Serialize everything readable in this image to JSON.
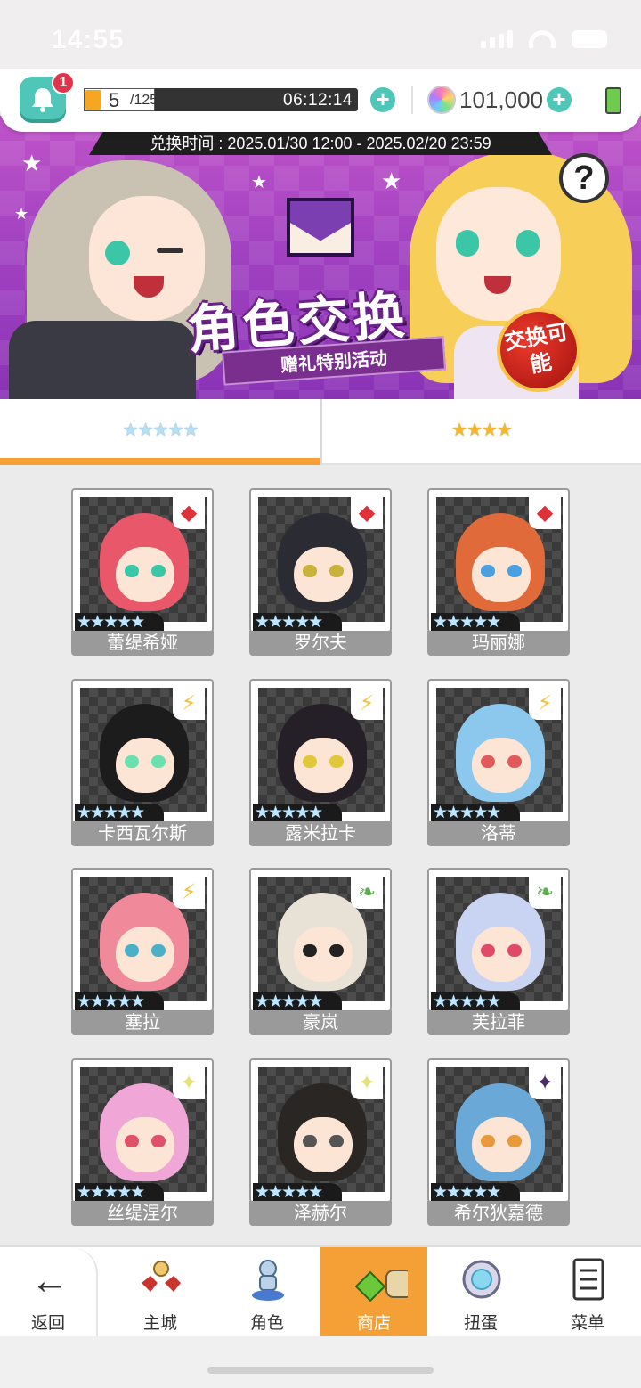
{
  "status_bar": {
    "time": "14:55"
  },
  "top_bar": {
    "notification_count": "1",
    "stamina_current": "5",
    "stamina_max": "/125",
    "stamina_fraction": 0.04,
    "stamina_timer": "06:12:14",
    "gems": "101,000"
  },
  "banner": {
    "exchange_time": "兑换时间 : 2025.01/30 12:00 - 2025.02/20 23:59",
    "title": "角色交换",
    "subtitle": "赠礼特别活动",
    "seal_text": "交换可能",
    "help_symbol": "?"
  },
  "tabs": [
    {
      "stars": "★★★★★",
      "active": true
    },
    {
      "stars": "★★★★",
      "active": false
    }
  ],
  "characters": [
    {
      "name": "蕾缇希娅",
      "rank": "★★★★★",
      "element": "fire",
      "hair": "#e8586a",
      "eye": "#3cc6a8"
    },
    {
      "name": "罗尔夫",
      "rank": "★★★★★",
      "element": "fire",
      "hair": "#2b2b33",
      "eye": "#c8b23a"
    },
    {
      "name": "玛丽娜",
      "rank": "★★★★★",
      "element": "fire",
      "hair": "#e06a3a",
      "eye": "#4aa0e0"
    },
    {
      "name": "卡西瓦尔斯",
      "rank": "★★★★★",
      "element": "lightning",
      "hair": "#1c1c1c",
      "eye": "#6ae0b0"
    },
    {
      "name": "露米拉卡",
      "rank": "★★★★★",
      "element": "lightning",
      "hair": "#252028",
      "eye": "#e0c83a"
    },
    {
      "name": "洛蒂",
      "rank": "★★★★★",
      "element": "lightning",
      "hair": "#8cc8ee",
      "eye": "#e05a5a"
    },
    {
      "name": "塞拉",
      "rank": "★★★★★",
      "element": "lightning",
      "hair": "#f08a9a",
      "eye": "#4ab0c8"
    },
    {
      "name": "豪岚",
      "rank": "★★★★★",
      "element": "nature",
      "hair": "#e8e2d6",
      "eye": "#222222"
    },
    {
      "name": "芙拉菲",
      "rank": "★★★★★",
      "element": "nature",
      "hair": "#c9d4f2",
      "eye": "#e04a6a"
    },
    {
      "name": "丝缇涅尔",
      "rank": "★★★★★",
      "element": "light",
      "hair": "#f0a6d6",
      "eye": "#e0506a"
    },
    {
      "name": "泽赫尔",
      "rank": "★★★★★",
      "element": "light",
      "hair": "#2a2624",
      "eye": "#555555"
    },
    {
      "name": "希尔狄嘉德",
      "rank": "★★★★★",
      "element": "dark",
      "hair": "#6aa8d8",
      "eye": "#e89a3a"
    }
  ],
  "element_icons": {
    "fire": {
      "glyph": "◆",
      "color": "#e0303a"
    },
    "lightning": {
      "glyph": "⚡",
      "color": "#f2c23a"
    },
    "nature": {
      "glyph": "❧",
      "color": "#5ab04a"
    },
    "light": {
      "glyph": "✦",
      "color": "#e8e07a"
    },
    "dark": {
      "glyph": "✦",
      "color": "#4a2a6a"
    }
  },
  "bottom_nav": {
    "back": "返回",
    "items": [
      {
        "label": "主城",
        "icon": "castle-icon"
      },
      {
        "label": "角色",
        "icon": "character-icon"
      },
      {
        "label": "商店",
        "icon": "shop-icon",
        "active": true
      },
      {
        "label": "扭蛋",
        "icon": "gacha-icon"
      },
      {
        "label": "菜单",
        "icon": "menu-icon"
      }
    ]
  }
}
